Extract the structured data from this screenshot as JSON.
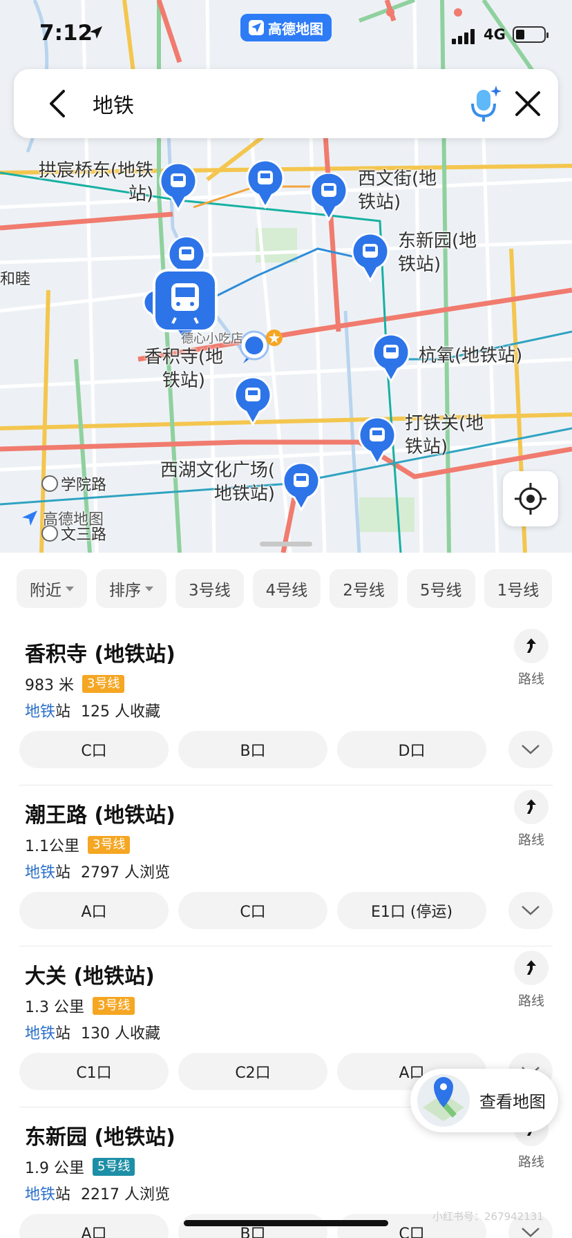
{
  "status_bar": {
    "time": "7:12",
    "network": "4G"
  },
  "brand": {
    "label": "高德地图"
  },
  "search": {
    "query": "地铁"
  },
  "map": {
    "station_labels": [
      {
        "text": "拱宸桥东(地铁\n站)"
      },
      {
        "text": "西文街(地\n铁站)"
      },
      {
        "text": "东新园(地\n铁站)"
      },
      {
        "text": "香积寺(地\n铁站)"
      },
      {
        "text": "杭氧(地铁站)"
      },
      {
        "text": "打铁关(地\n铁站)"
      },
      {
        "text": "西湖文化广场(\n地铁站)"
      }
    ],
    "poi_label": "德心小吃店",
    "area_label": "和睦",
    "road_labels": [
      "学院路",
      "文三路"
    ],
    "watermark": "高德地图"
  },
  "filters": [
    {
      "label": "附近",
      "dropdown": true
    },
    {
      "label": "排序",
      "dropdown": true
    },
    {
      "label": "3号线"
    },
    {
      "label": "4号线"
    },
    {
      "label": "2号线"
    },
    {
      "label": "5号线"
    },
    {
      "label": "1号线"
    }
  ],
  "results": [
    {
      "name": "香积寺 (地铁站)",
      "distance": "983 米",
      "line": "3号线",
      "line_color": "#f5a623",
      "category": "地铁",
      "category_suffix": "站",
      "stat": "125 人收藏",
      "route_label": "路线",
      "exits": [
        "C口",
        "B口",
        "D口"
      ]
    },
    {
      "name": "潮王路 (地铁站)",
      "distance": "1.1公里",
      "line": "3号线",
      "line_color": "#f5a623",
      "category": "地铁",
      "category_suffix": "站",
      "stat": "2797 人浏览",
      "route_label": "路线",
      "exits": [
        "A口",
        "C口",
        "E1口 (停运)"
      ]
    },
    {
      "name": "大关 (地铁站)",
      "distance": "1.3 公里",
      "line": "3号线",
      "line_color": "#f5a623",
      "category": "地铁",
      "category_suffix": "站",
      "stat": "130 人收藏",
      "route_label": "路线",
      "exits": [
        "C1口",
        "C2口",
        "A口"
      ]
    },
    {
      "name": "东新园 (地铁站)",
      "distance": "1.9 公里",
      "line": "5号线",
      "line_color": "#1d8fa6",
      "category": "地铁",
      "category_suffix": "站",
      "stat": "2217 人浏览",
      "route_label": "路线",
      "exits": [
        "A口",
        "B口",
        "C口"
      ]
    }
  ],
  "view_map_label": "查看地图",
  "footer_watermark": "小红书号：267942131",
  "colors": {
    "accent": "#2d7cf6",
    "line3": "#f5a623",
    "line5": "#1d8fa6"
  }
}
